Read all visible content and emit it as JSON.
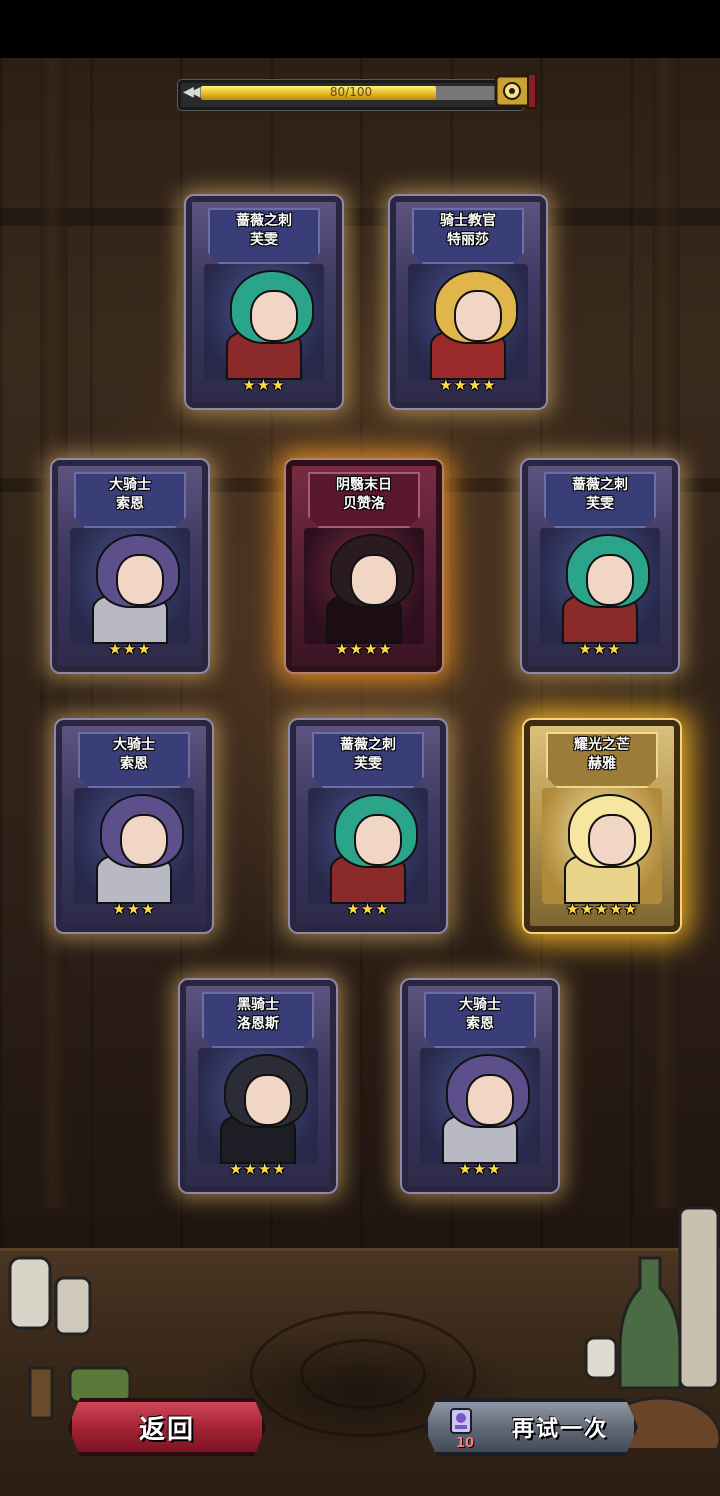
{
  "progress": {
    "text": "80/100",
    "value": 80,
    "max": 100
  },
  "cards": [
    {
      "id": "c1",
      "name": "蔷薇之刺\n芙雯",
      "stars": "★★★",
      "rarity": 3
    },
    {
      "id": "c2",
      "name": "骑士教官\n特丽莎",
      "stars": "★★★★",
      "rarity": 3
    },
    {
      "id": "c3",
      "name": "大骑士\n索恩",
      "stars": "★★★",
      "rarity": 3
    },
    {
      "id": "c4",
      "name": "阴翳末日\n贝赞洛",
      "stars": "★★★★",
      "rarity": 4
    },
    {
      "id": "c5",
      "name": "蔷薇之刺\n芙雯",
      "stars": "★★★",
      "rarity": 3
    },
    {
      "id": "c6",
      "name": "大骑士\n索恩",
      "stars": "★★★",
      "rarity": 3
    },
    {
      "id": "c7",
      "name": "蔷薇之刺\n芙雯",
      "stars": "★★★",
      "rarity": 3
    },
    {
      "id": "c8",
      "name": "耀光之芒\n赫雅",
      "stars": "★★★★★",
      "rarity": 5
    },
    {
      "id": "c9",
      "name": "黑骑士\n洛恩斯",
      "stars": "★★★★",
      "rarity": 3
    },
    {
      "id": "c10",
      "name": "大骑士\n索恩",
      "stars": "★★★",
      "rarity": 3
    }
  ],
  "buttons": {
    "back": "返回",
    "retry": "再试一次",
    "retry_cost": "10"
  },
  "colors": {
    "star": "#ffd84a",
    "back_button": "#a12234",
    "retry_button": "#5f6775",
    "progress_fill": "#e3b41b"
  }
}
